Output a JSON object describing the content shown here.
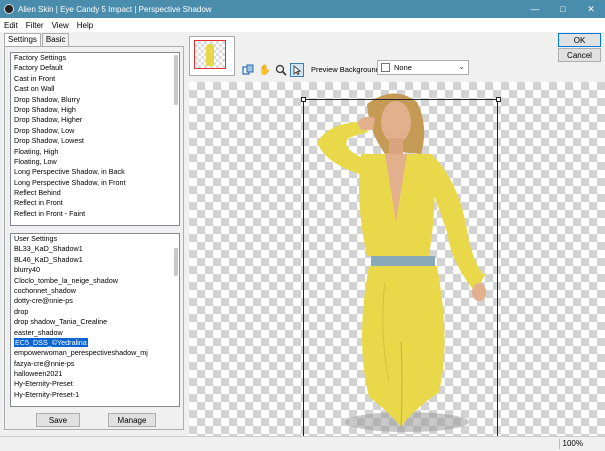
{
  "window": {
    "title": "Alien Skin | Eye Candy 5 Impact | Perspective Shadow"
  },
  "menu": [
    "Edit",
    "Filter",
    "View",
    "Help"
  ],
  "tabs": {
    "settings": "Settings",
    "basic": "Basic"
  },
  "factory": {
    "header": "Factory Settings",
    "items": [
      "Factory Default",
      "Cast in Front",
      "Cast on Wall",
      "Drop Shadow, Blurry",
      "Drop Shadow, High",
      "Drop Shadow, Higher",
      "Drop Shadow, Low",
      "Drop Shadow, Lowest",
      "Floating, High",
      "Floating, Low",
      "Long Perspective Shadow, in Back",
      "Long Perspective Shadow, in Front",
      "Reflect Behind",
      "Reflect in Front",
      "Reflect in Front - Faint"
    ]
  },
  "user": {
    "header": "User Settings",
    "items": [
      "BL33_KaD_Shadow1",
      "BL46_KaD_Shadow1",
      "blurry40",
      "Cloclo_tombe_la_neige_shadow",
      "cochonnet_shadow",
      "dotty-cre@nnie-ps",
      "drop",
      "drop shadow_Tania_Crealine",
      "easter_shadow",
      "EC5_DSS_©Yedralina",
      "empowerwoman_perespectiveshadow_mj",
      "fazya-cre@nnie-ps",
      "halloween2021",
      "Hy-Eternity-Preset",
      "Hy-Eternity-Preset-1"
    ],
    "selected_index": 9
  },
  "buttons": {
    "save": "Save",
    "manage": "Manage",
    "ok": "OK",
    "cancel": "Cancel"
  },
  "preview": {
    "label": "Preview Background:",
    "value": "None"
  },
  "status": {
    "zoom": "100%"
  },
  "colors": {
    "titlebar": "#4a8cab",
    "selection": "#0a64d2",
    "dress": "#e9d94a"
  }
}
